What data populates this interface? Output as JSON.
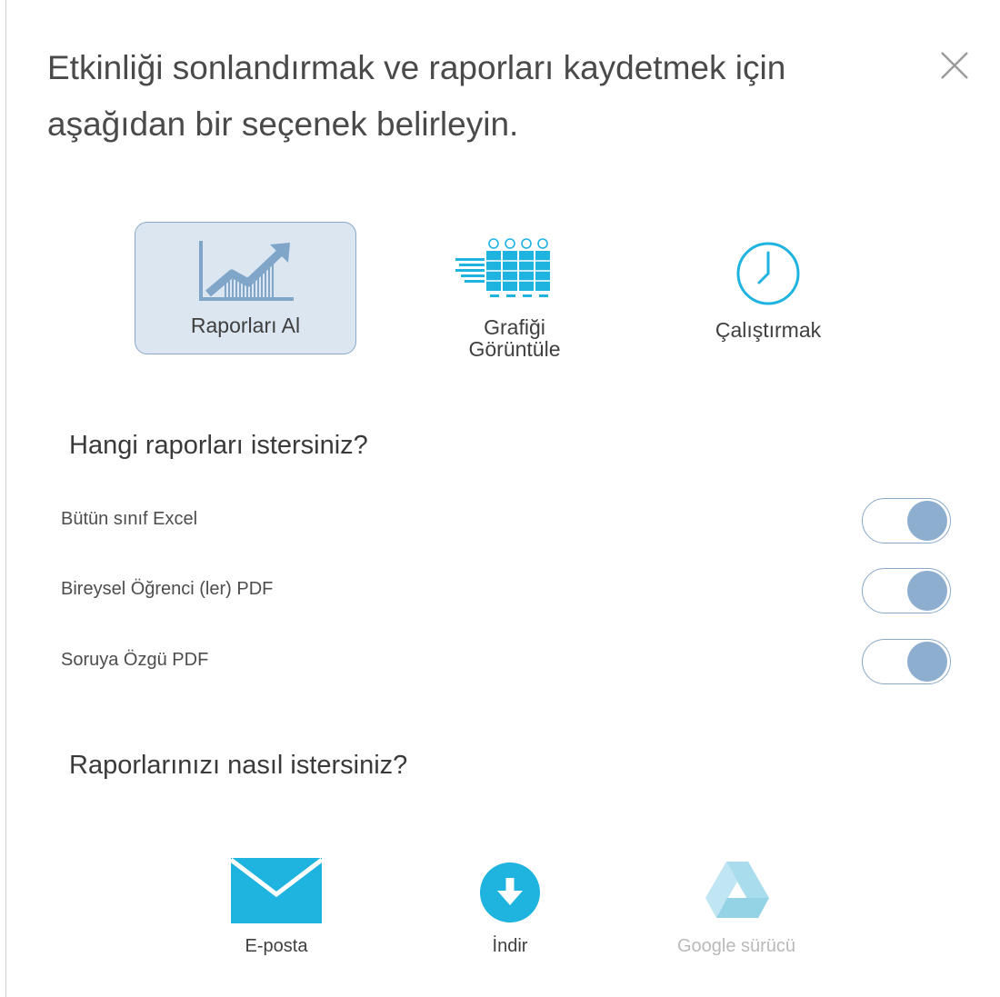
{
  "dialog": {
    "title": "Etkinliği sonlandırmak ve raporları kaydetmek için aşağıdan bir seçenek belirleyin.",
    "close_icon": "close-icon"
  },
  "modes": {
    "reports": {
      "label": "Raporları Al",
      "icon": "line-chart-icon",
      "selected": true
    },
    "chart": {
      "label_line1": "Grafiği",
      "label_line2": "Görüntüle",
      "icon": "results-grid-icon",
      "selected": false
    },
    "run": {
      "label": "Çalıştırmak",
      "icon": "clock-icon",
      "selected": false
    }
  },
  "report_types": {
    "heading": "Hangi raporları istersiniz?",
    "options": [
      {
        "label": "Bütün sınıf Excel",
        "enabled": true
      },
      {
        "label": "Bireysel Öğrenci (ler) PDF",
        "enabled": true
      },
      {
        "label": "Soruya Özgü PDF",
        "enabled": true
      }
    ]
  },
  "delivery": {
    "heading": "Raporlarınızı nasıl istersiniz?",
    "methods": [
      {
        "label": "E-posta",
        "icon": "envelope-icon",
        "enabled": true
      },
      {
        "label": "İndir",
        "icon": "download-icon",
        "enabled": true
      },
      {
        "label": "Google sürücü",
        "icon": "google-drive-icon",
        "enabled": false
      }
    ]
  },
  "colors": {
    "accent": "#1fb3e0",
    "selected_bg": "#dbe6f1",
    "toggle_border": "#8aa9c9",
    "toggle_knob": "#8eaed0",
    "disabled_text": "#b9b9b9"
  }
}
